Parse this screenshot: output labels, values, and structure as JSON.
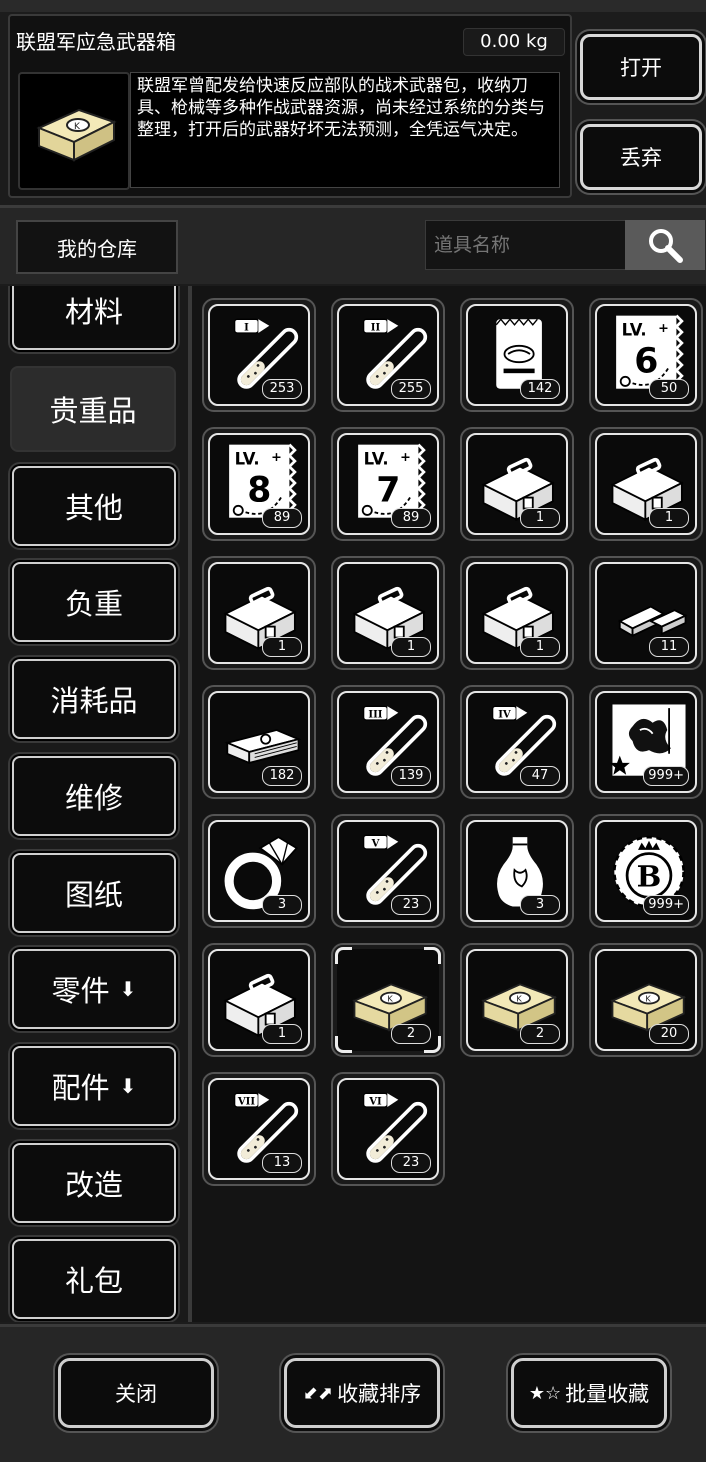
{
  "header": {
    "title": "联盟军应急武器箱",
    "weight": "0.00 kg",
    "description": "联盟军曾配发给快速反应部队的战术武器包，收纳刀具、枪械等多种作战武器资源，尚未经过系统的分类与整理，打开后的武器好坏无法预测，全凭运气决定。",
    "open_label": "打开",
    "discard_label": "丢弃"
  },
  "toolbar": {
    "warehouse_label": "我的仓库",
    "search_placeholder": "道具名称"
  },
  "categories": [
    {
      "label": "材料"
    },
    {
      "label": "贵重品",
      "active": true
    },
    {
      "label": "其他"
    },
    {
      "label": "负重"
    },
    {
      "label": "消耗品"
    },
    {
      "label": "维修"
    },
    {
      "label": "图纸"
    },
    {
      "label": "零件",
      "has_arrow": true
    },
    {
      "label": "配件",
      "has_arrow": true
    },
    {
      "label": "改造"
    },
    {
      "label": "礼包"
    }
  ],
  "items": [
    {
      "icon": "vial-I-icon",
      "count": "253"
    },
    {
      "icon": "vial-II-icon",
      "count": "255"
    },
    {
      "icon": "seed-bag-icon",
      "count": "142"
    },
    {
      "icon": "level-ticket-6-icon",
      "count": "50"
    },
    {
      "icon": "level-ticket-8-icon",
      "count": "89"
    },
    {
      "icon": "level-ticket-7-icon",
      "count": "89"
    },
    {
      "icon": "toolbox-icon",
      "count": "1"
    },
    {
      "icon": "toolbox-icon",
      "count": "1"
    },
    {
      "icon": "toolbox-icon",
      "count": "1"
    },
    {
      "icon": "toolbox-icon",
      "count": "1"
    },
    {
      "icon": "toolbox-icon",
      "count": "1"
    },
    {
      "icon": "gold-bar-icon",
      "count": "11"
    },
    {
      "icon": "cash-stack-icon",
      "count": "182"
    },
    {
      "icon": "vial-III-icon",
      "count": "139"
    },
    {
      "icon": "vial-IV-icon",
      "count": "47"
    },
    {
      "icon": "map-card-icon",
      "count": "999+"
    },
    {
      "icon": "diamond-ring-icon",
      "count": "3"
    },
    {
      "icon": "vial-V-icon",
      "count": "23"
    },
    {
      "icon": "vase-icon",
      "count": "3"
    },
    {
      "icon": "b-coin-icon",
      "count": "999+"
    },
    {
      "icon": "toolbox-icon",
      "count": "1"
    },
    {
      "icon": "weapon-case-icon",
      "count": "2",
      "selected": true
    },
    {
      "icon": "weapon-case-icon",
      "count": "2"
    },
    {
      "icon": "weapon-case-icon",
      "count": "20"
    },
    {
      "icon": "vial-VII-icon",
      "count": "13"
    },
    {
      "icon": "vial-VI-icon",
      "count": "23"
    }
  ],
  "footer": {
    "close_label": "关闭",
    "sort_label": "收藏排序",
    "batch_label": "批量收藏"
  },
  "colors": {
    "background": "#1c1c1c",
    "border_light": "#d8d8d8",
    "case_yellow": "#f0e6b0"
  }
}
